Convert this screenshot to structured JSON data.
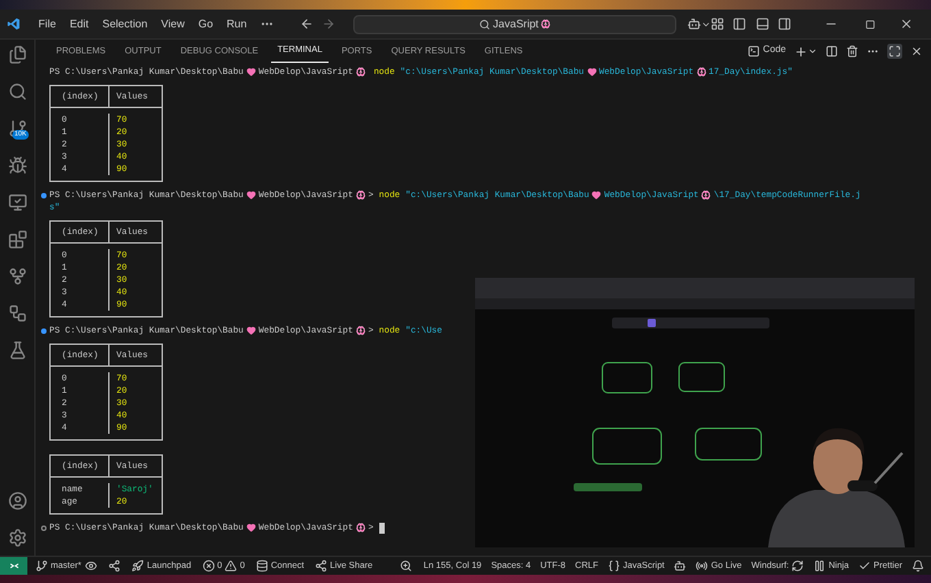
{
  "window": {
    "menus": [
      "File",
      "Edit",
      "Selection",
      "View",
      "Go",
      "Run"
    ],
    "search": {
      "value": "JavaSript"
    }
  },
  "activity_bar": {
    "source_control_badge": "10K"
  },
  "panel": {
    "tabs": [
      {
        "label": "PROBLEMS",
        "selected": false
      },
      {
        "label": "OUTPUT",
        "selected": false
      },
      {
        "label": "DEBUG CONSOLE",
        "selected": false
      },
      {
        "label": "TERMINAL",
        "selected": true
      },
      {
        "label": "PORTS",
        "selected": false
      },
      {
        "label": "QUERY RESULTS",
        "selected": false
      },
      {
        "label": "GITLENS",
        "selected": false
      }
    ],
    "terminal_profile": "Code"
  },
  "terminal": {
    "lines": [
      {
        "kind": "prompt",
        "path": [
          {
            "kind": "text",
            "text": "PS C:\\Users\\Pankaj Kumar\\Desktop\\Babu"
          },
          {
            "kind": "heart"
          },
          {
            "kind": "text",
            "text": "WebDelop\\JavaSript"
          },
          {
            "kind": "brain"
          }
        ],
        "command": "node",
        "args": [
          {
            "kind": "text",
            "text": "\"c:\\Users\\Pankaj Kumar\\Desktop\\Babu"
          },
          {
            "kind": "heart"
          },
          {
            "kind": "text",
            "text": "WebDelop\\JavaSript"
          },
          {
            "kind": "brain"
          },
          {
            "kind": "text",
            "text": "17_Day\\index.js\""
          }
        ]
      },
      {
        "kind": "table",
        "columns": [
          "(index)",
          "Values"
        ],
        "rows": [
          {
            "index": "0",
            "value": "70",
            "kind": "number"
          },
          {
            "index": "1",
            "value": "20",
            "kind": "number"
          },
          {
            "index": "2",
            "value": "30",
            "kind": "number"
          },
          {
            "index": "3",
            "value": "40",
            "kind": "number"
          },
          {
            "index": "4",
            "value": "90",
            "kind": "number"
          }
        ]
      },
      {
        "kind": "prompt",
        "completed": true,
        "path": [
          {
            "kind": "text",
            "text": "PS C:\\Users\\Pankaj Kumar\\Desktop\\Babu"
          },
          {
            "kind": "heart"
          },
          {
            "kind": "text",
            "text": "WebDelop\\JavaSript"
          },
          {
            "kind": "brain"
          }
        ],
        "caret": ">",
        "command": "node",
        "args": [
          {
            "kind": "text",
            "text": "\"c:\\Users\\Pankaj Kumar\\Desktop\\Babu"
          },
          {
            "kind": "heart"
          },
          {
            "kind": "text",
            "text": "WebDelop\\JavaSript"
          },
          {
            "kind": "brain"
          },
          {
            "kind": "text",
            "text": "\\17_Day\\tempCodeRunnerFile.j"
          }
        ],
        "continuation": "s\""
      },
      {
        "kind": "table",
        "columns": [
          "(index)",
          "Values"
        ],
        "rows": [
          {
            "index": "0",
            "value": "70",
            "kind": "number"
          },
          {
            "index": "1",
            "value": "20",
            "kind": "number"
          },
          {
            "index": "2",
            "value": "30",
            "kind": "number"
          },
          {
            "index": "3",
            "value": "40",
            "kind": "number"
          },
          {
            "index": "4",
            "value": "90",
            "kind": "number"
          }
        ]
      },
      {
        "kind": "prompt",
        "completed": true,
        "path": [
          {
            "kind": "text",
            "text": "PS C:\\Users\\Pankaj Kumar\\Desktop\\Babu"
          },
          {
            "kind": "heart"
          },
          {
            "kind": "text",
            "text": "WebDelop\\JavaSript"
          },
          {
            "kind": "brain"
          }
        ],
        "caret": ">",
        "command": "node",
        "args": [
          {
            "kind": "text",
            "text": "\"c:\\Use"
          }
        ]
      },
      {
        "kind": "table",
        "columns": [
          "(index)",
          "Values"
        ],
        "rows": [
          {
            "index": "0",
            "value": "70",
            "kind": "number"
          },
          {
            "index": "1",
            "value": "20",
            "kind": "number"
          },
          {
            "index": "2",
            "value": "30",
            "kind": "number"
          },
          {
            "index": "3",
            "value": "40",
            "kind": "number"
          },
          {
            "index": "4",
            "value": "90",
            "kind": "number"
          }
        ]
      },
      {
        "kind": "table",
        "columns": [
          "(index)",
          "Values"
        ],
        "rows": [
          {
            "index": "name",
            "value": "'Saroj'",
            "kind": "string"
          },
          {
            "index": "age",
            "value": "20",
            "kind": "number"
          }
        ]
      },
      {
        "kind": "prompt",
        "completed": false,
        "path": [
          {
            "kind": "text",
            "text": "PS C:\\Users\\Pankaj Kumar\\Desktop\\Babu"
          },
          {
            "kind": "heart"
          },
          {
            "kind": "text",
            "text": "WebDelop\\JavaSript"
          },
          {
            "kind": "brain"
          }
        ],
        "caret": ">",
        "cursor": true
      }
    ]
  },
  "status_bar": {
    "branch": "master*",
    "launchpad": "Launchpad",
    "errors": "0",
    "warnings": "0",
    "connect": "Connect",
    "live_share": "Live Share",
    "items": [
      "Ln 155, Col 19",
      "Spaces: 4",
      "UTF-8",
      "CRLF"
    ],
    "language": "JavaScript",
    "go_live": "Go Live",
    "windsurf": "Windsurf:",
    "ninja": "Ninja",
    "prettier": "Prettier"
  }
}
